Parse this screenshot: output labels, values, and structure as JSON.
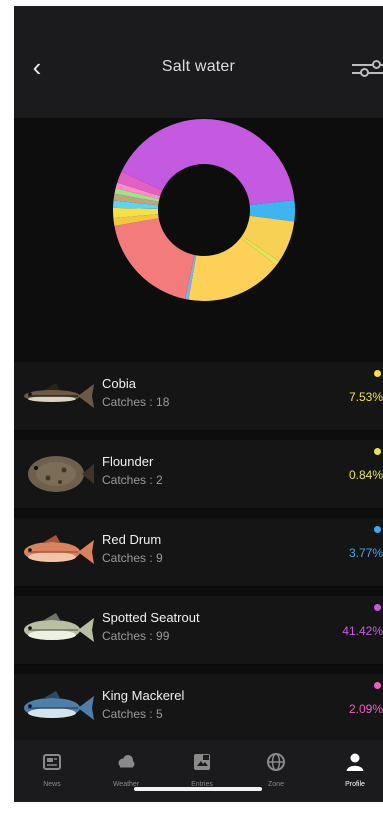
{
  "header": {
    "title": "Salt water",
    "back_icon": "chevron-left-icon",
    "filter_icon": "sliders-icon"
  },
  "chart_data": {
    "type": "pie",
    "variant": "donut",
    "slices": [
      {
        "label": "Spotted Seatrout",
        "percent": 41.42,
        "color": "#c45ae0"
      },
      {
        "label": "Red Drum",
        "percent": 3.77,
        "color": "#3fb5f0"
      },
      {
        "label": "Cobia",
        "percent": 7.53,
        "color": "#f7d154"
      },
      {
        "label": "Flounder",
        "percent": 0.84,
        "color": "#e8e355"
      },
      {
        "label": "",
        "percent": 17.4,
        "color": "#fdd158"
      },
      {
        "label": "",
        "percent": 0.6,
        "color": "#7bb3e6"
      },
      {
        "label": "",
        "percent": 18.9,
        "color": "#f47b7b"
      },
      {
        "label": "",
        "percent": 1.4,
        "color": "#f2c744"
      },
      {
        "label": "",
        "percent": 1.8,
        "color": "#f5e04a"
      },
      {
        "label": "",
        "percent": 1.3,
        "color": "#5fd4f2"
      },
      {
        "label": "",
        "percent": 1.2,
        "color": "#bca87a"
      },
      {
        "label": "",
        "percent": 1.0,
        "color": "#a3e08a"
      },
      {
        "label": "",
        "percent": 1.0,
        "color": "#ff8fc8"
      },
      {
        "label": "King Mackerel",
        "percent": 2.09,
        "color": "#e25fc4"
      }
    ]
  },
  "species": [
    {
      "name": "Cobia",
      "catches": "Catches : 18",
      "percent": "7.53%",
      "color": "#f2e24a",
      "icon": "cobia-fish-icon"
    },
    {
      "name": "Flounder",
      "catches": "Catches : 2",
      "percent": "0.84%",
      "color": "#e8e355",
      "icon": "flounder-fish-icon"
    },
    {
      "name": "Red Drum",
      "catches": "Catches : 9",
      "percent": "3.77%",
      "color": "#3fa9f0",
      "icon": "red-drum-fish-icon"
    },
    {
      "name": "Spotted Seatrout",
      "catches": "Catches : 99",
      "percent": "41.42%",
      "color": "#c45ae0",
      "icon": "seatrout-fish-icon"
    },
    {
      "name": "King Mackerel",
      "catches": "Catches : 5",
      "percent": "2.09%",
      "color": "#ef5fc8",
      "icon": "mackerel-fish-icon"
    }
  ],
  "tabs": [
    {
      "label": "News",
      "icon": "newspaper-icon",
      "active": false
    },
    {
      "label": "Weather",
      "icon": "cloud-icon",
      "active": false
    },
    {
      "label": "Entries",
      "icon": "entries-icon",
      "active": false
    },
    {
      "label": "Zone",
      "icon": "globe-icon",
      "active": false
    },
    {
      "label": "Profile",
      "icon": "person-icon",
      "active": true
    }
  ],
  "colors": {
    "background": "#0d0d0d",
    "bar": "#1b1b1d",
    "row": "#151516"
  }
}
